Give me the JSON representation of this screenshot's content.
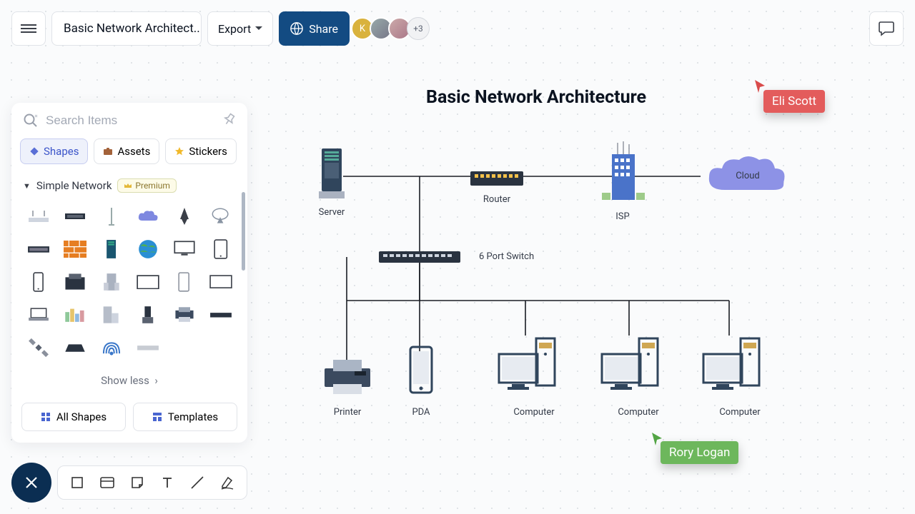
{
  "header": {
    "doc_title": "Basic Network Architect...",
    "export_label": "Export",
    "share_label": "Share",
    "avatar_more": "+3",
    "avatar_letter": "K"
  },
  "sidebar": {
    "search_placeholder": "Search Items",
    "tabs": {
      "shapes": "Shapes",
      "assets": "Assets",
      "stickers": "Stickers"
    },
    "category": {
      "name": "Simple Network",
      "badge": "Premium"
    },
    "show_less": "Show less",
    "footer": {
      "all_shapes": "All Shapes",
      "templates": "Templates"
    }
  },
  "diagram": {
    "title": "Basic Network Architecture",
    "labels": {
      "server": "Server",
      "router": "Router",
      "isp": "ISP",
      "cloud": "Cloud",
      "switch": "6 Port Switch",
      "printer": "Printer",
      "pda": "PDA",
      "computer1": "Computer",
      "computer2": "Computer",
      "computer3": "Computer"
    }
  },
  "collaborators": {
    "eli": "Eli Scott",
    "rory": "Rory Logan"
  }
}
